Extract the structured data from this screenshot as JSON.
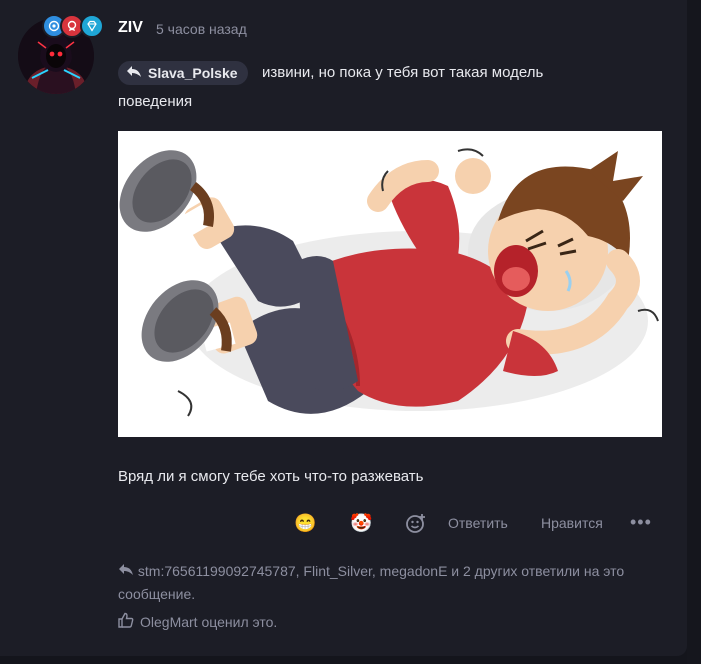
{
  "post": {
    "username": "ZIV",
    "time": "5 часов назад",
    "reply_to": "Slava_Polske",
    "message_line1": "извини, но пока у тебя вот такая модель",
    "message_line2": "поведения",
    "caption": "Вряд ли я смогу тебе хоть что-то разжевать"
  },
  "actions": {
    "emoji1": "😁",
    "emoji2": "🤡",
    "reply_label": "Ответить",
    "like_label": "Нравится",
    "more": "•••"
  },
  "footer": {
    "replies_text": "stm:76561199092745787, Flint_Silver, megadonE и 2 других ответили на это сообщение.",
    "liked_text": "OlegMart оценил это."
  },
  "colors": {
    "background": "#1c1d26",
    "muted_text": "#8d8fa0",
    "chip_bg": "#2f3140",
    "badge_blue": "#2f8ee0",
    "badge_red": "#d8343d",
    "badge_cyan": "#1fa6d6"
  },
  "icons": {
    "reply_chip": "reply-arrow-icon",
    "add_reaction": "add-emoji-icon",
    "replies": "reply-arrow-icon",
    "like": "thumbs-up-icon"
  }
}
